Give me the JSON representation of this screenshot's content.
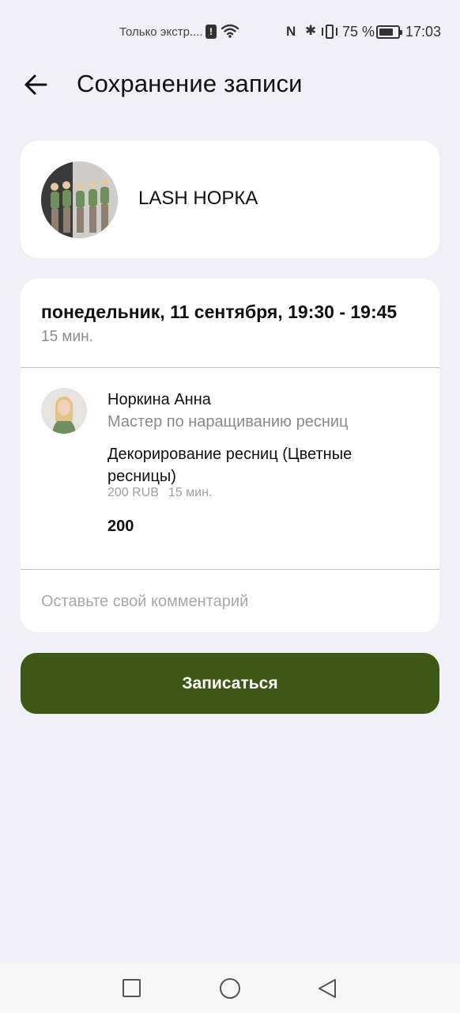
{
  "status_bar": {
    "notice": "Только экстр....",
    "alert": "!",
    "nfc": "N",
    "bluetooth": "✱",
    "battery_percent": "75 %",
    "battery_level": 0.75,
    "time": "17:03"
  },
  "header": {
    "title": "Сохранение записи"
  },
  "salon": {
    "name": "LASH НОРКА"
  },
  "booking": {
    "datetime": "понедельник, 11 сентября, 19:30 - 19:45",
    "duration": "15 мин.",
    "master": {
      "name": "Норкина Анна",
      "role": "Мастер по наращиванию ресниц"
    },
    "service": {
      "name": "Декорирование ресниц (Цветные ресницы)",
      "price": "200 RUB",
      "duration": "15 мин."
    },
    "total": "200",
    "comment": {
      "value": "",
      "placeholder": "Оставьте свой комментарий"
    }
  },
  "actions": {
    "submit_label": "Записаться"
  },
  "colors": {
    "accent": "#3f5716",
    "background": "#f1f0f6",
    "card": "#ffffff",
    "muted_text": "#8a8a8a"
  }
}
